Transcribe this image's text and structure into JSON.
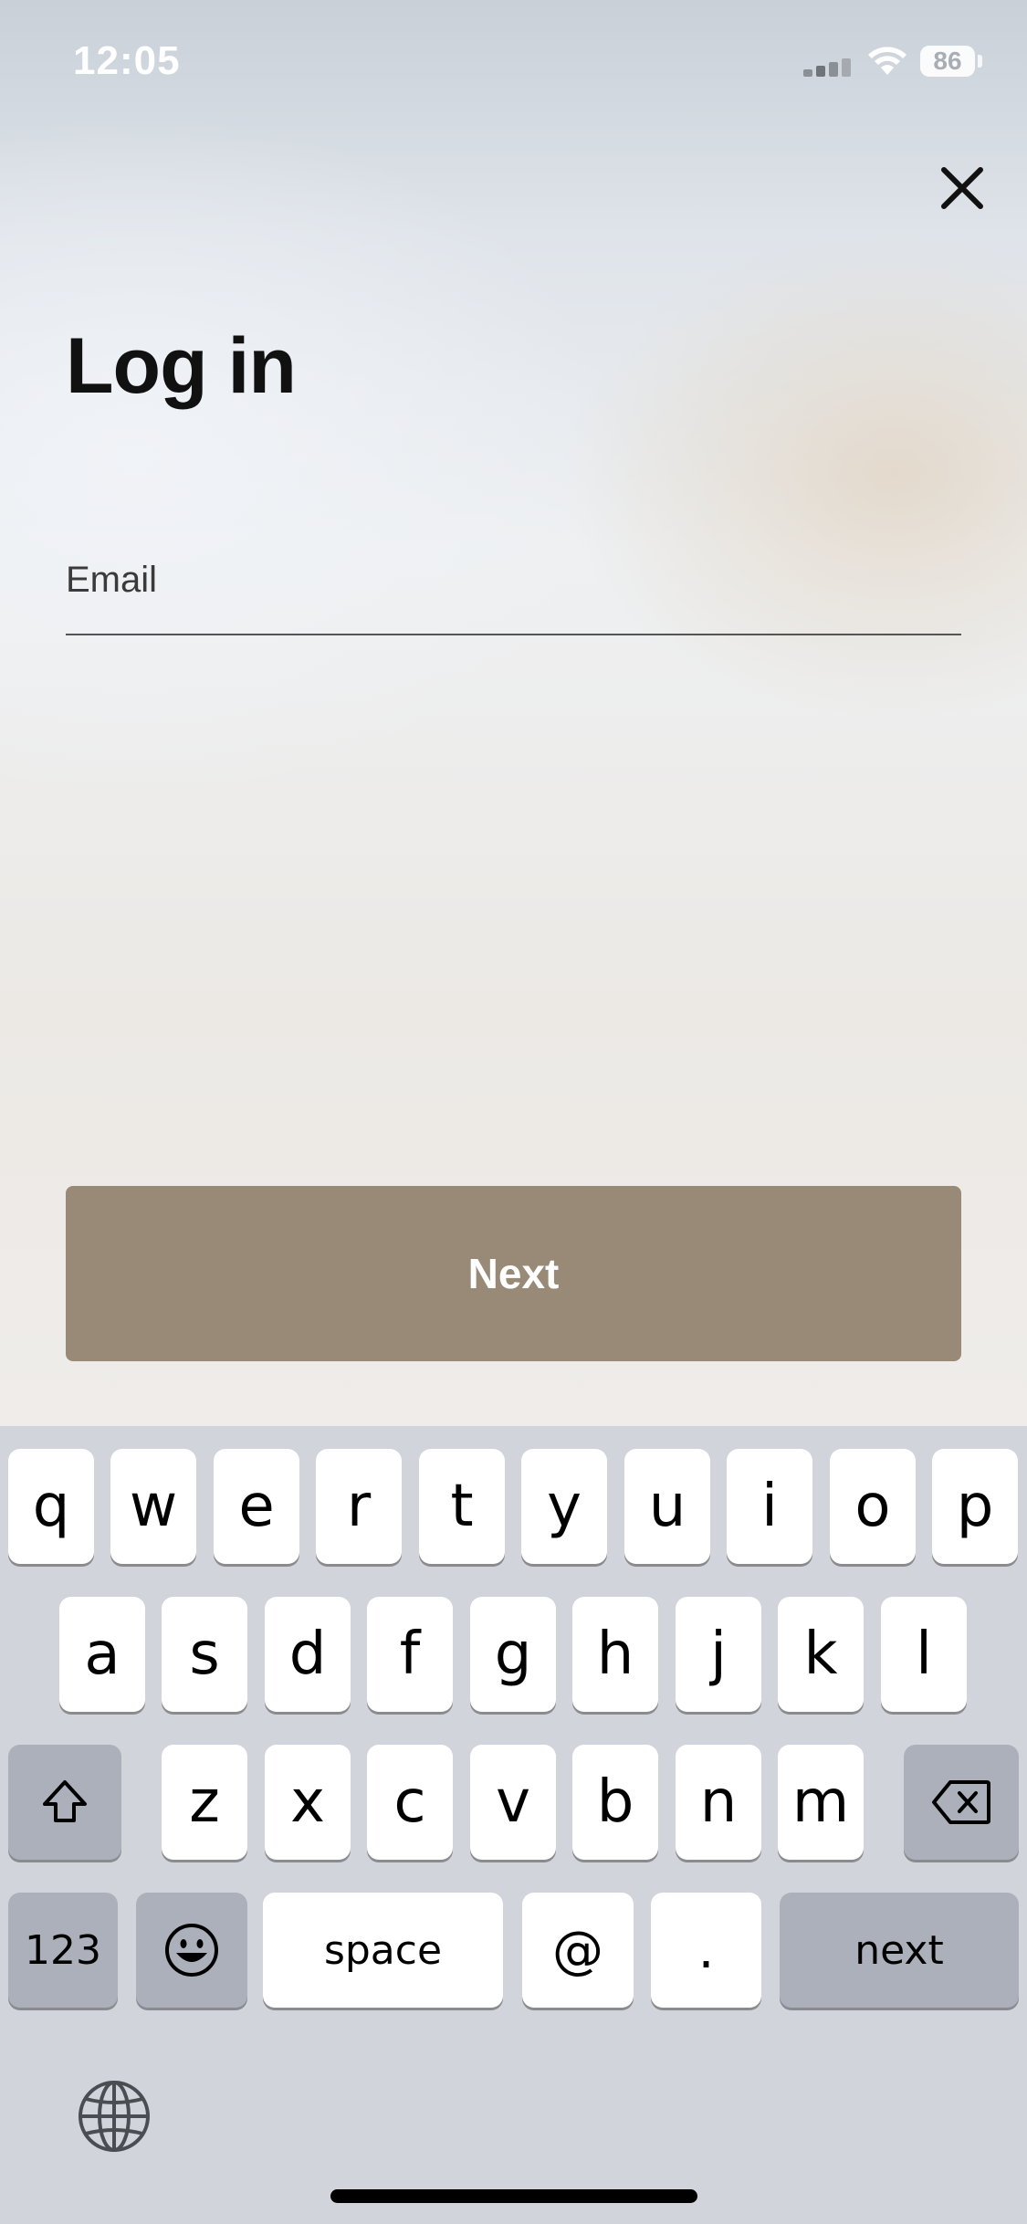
{
  "status_bar": {
    "time": "12:05",
    "battery": "86"
  },
  "header": {
    "close_icon": "close-icon",
    "title": "Log in"
  },
  "form": {
    "email_placeholder": "Email",
    "email_value": ""
  },
  "actions": {
    "next_label": "Next",
    "button_color": "#988a76"
  },
  "keyboard": {
    "row1": [
      "q",
      "w",
      "e",
      "r",
      "t",
      "y",
      "u",
      "i",
      "o",
      "p"
    ],
    "row2": [
      "a",
      "s",
      "d",
      "f",
      "g",
      "h",
      "j",
      "k",
      "l"
    ],
    "row3": [
      "z",
      "x",
      "c",
      "v",
      "b",
      "n",
      "m"
    ],
    "numbers_label": "123",
    "space_label": "space",
    "at_label": "@",
    "dot_label": ".",
    "return_label": "next",
    "shift_icon": "shift-icon",
    "delete_icon": "delete-icon",
    "emoji_icon": "emoji-icon",
    "globe_icon": "globe-icon"
  }
}
